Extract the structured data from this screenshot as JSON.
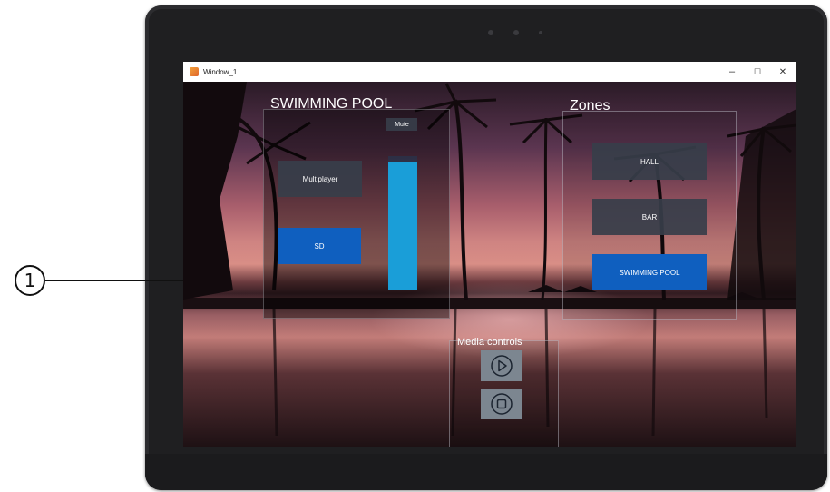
{
  "callout": {
    "number": "1"
  },
  "window": {
    "title": "Window_1",
    "minimize_glyph": "–",
    "maximize_glyph": "☐",
    "close_glyph": "✕"
  },
  "pool": {
    "title": "SWIMMING POOL",
    "multiplayer_label": "Multiplayer",
    "sd_label": "SD",
    "mute_label": "Mute",
    "volume_fraction": 0.95
  },
  "zones": {
    "title": "Zones",
    "items": [
      {
        "label": "HALL",
        "selected": false
      },
      {
        "label": "BAR",
        "selected": false
      },
      {
        "label": "SWIMMING POOL",
        "selected": true
      }
    ]
  },
  "media": {
    "title": "Media controls",
    "play_icon": "play-icon",
    "stop_icon": "stop-icon"
  },
  "colors": {
    "accent_blue": "#0f5fbf",
    "slider_blue": "#1a9ed8",
    "dark_button": "#373e4a"
  }
}
